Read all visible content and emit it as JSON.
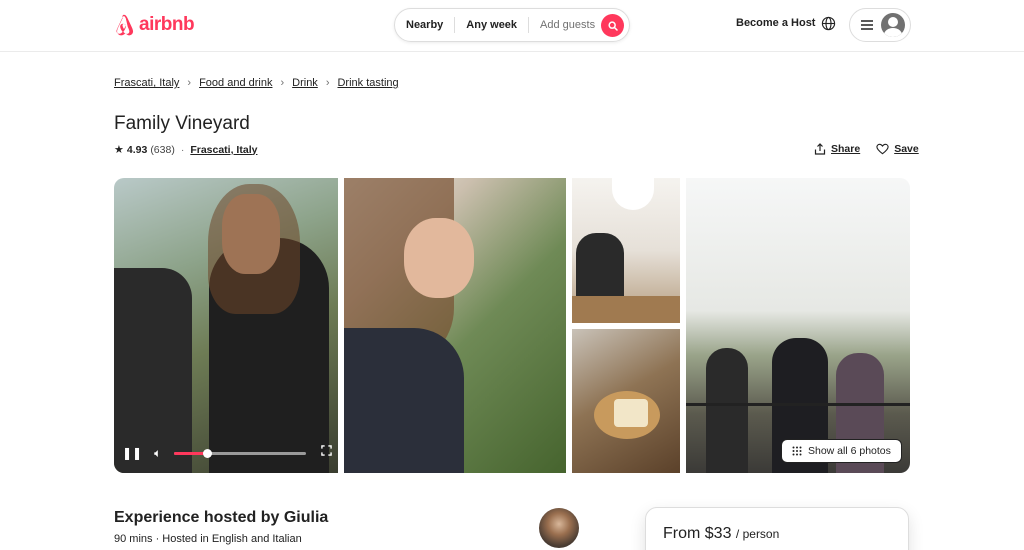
{
  "header": {
    "logo_text": "airbnb",
    "search": {
      "location": "Nearby",
      "dates": "Any week",
      "guests": "Add guests"
    },
    "host_link": "Become a Host"
  },
  "breadcrumb": [
    "Frascati, Italy",
    "Food and drink",
    "Drink",
    "Drink tasting"
  ],
  "listing": {
    "title": "Family Vineyard",
    "rating": "4.93",
    "review_count": "(638)",
    "location": "Frascati, Italy",
    "share_label": "Share",
    "save_label": "Save"
  },
  "gallery": {
    "show_all_label": "Show all 6 photos",
    "video_progress": 0.25
  },
  "host": {
    "title": "Experience hosted by Giulia",
    "subtitle": "90 mins · Hosted in English and Italian"
  },
  "price": {
    "amount": "From $33",
    "unit": "/ person"
  },
  "colors": {
    "brand": "#FF385C",
    "text": "#222222",
    "muted": "#717171"
  }
}
